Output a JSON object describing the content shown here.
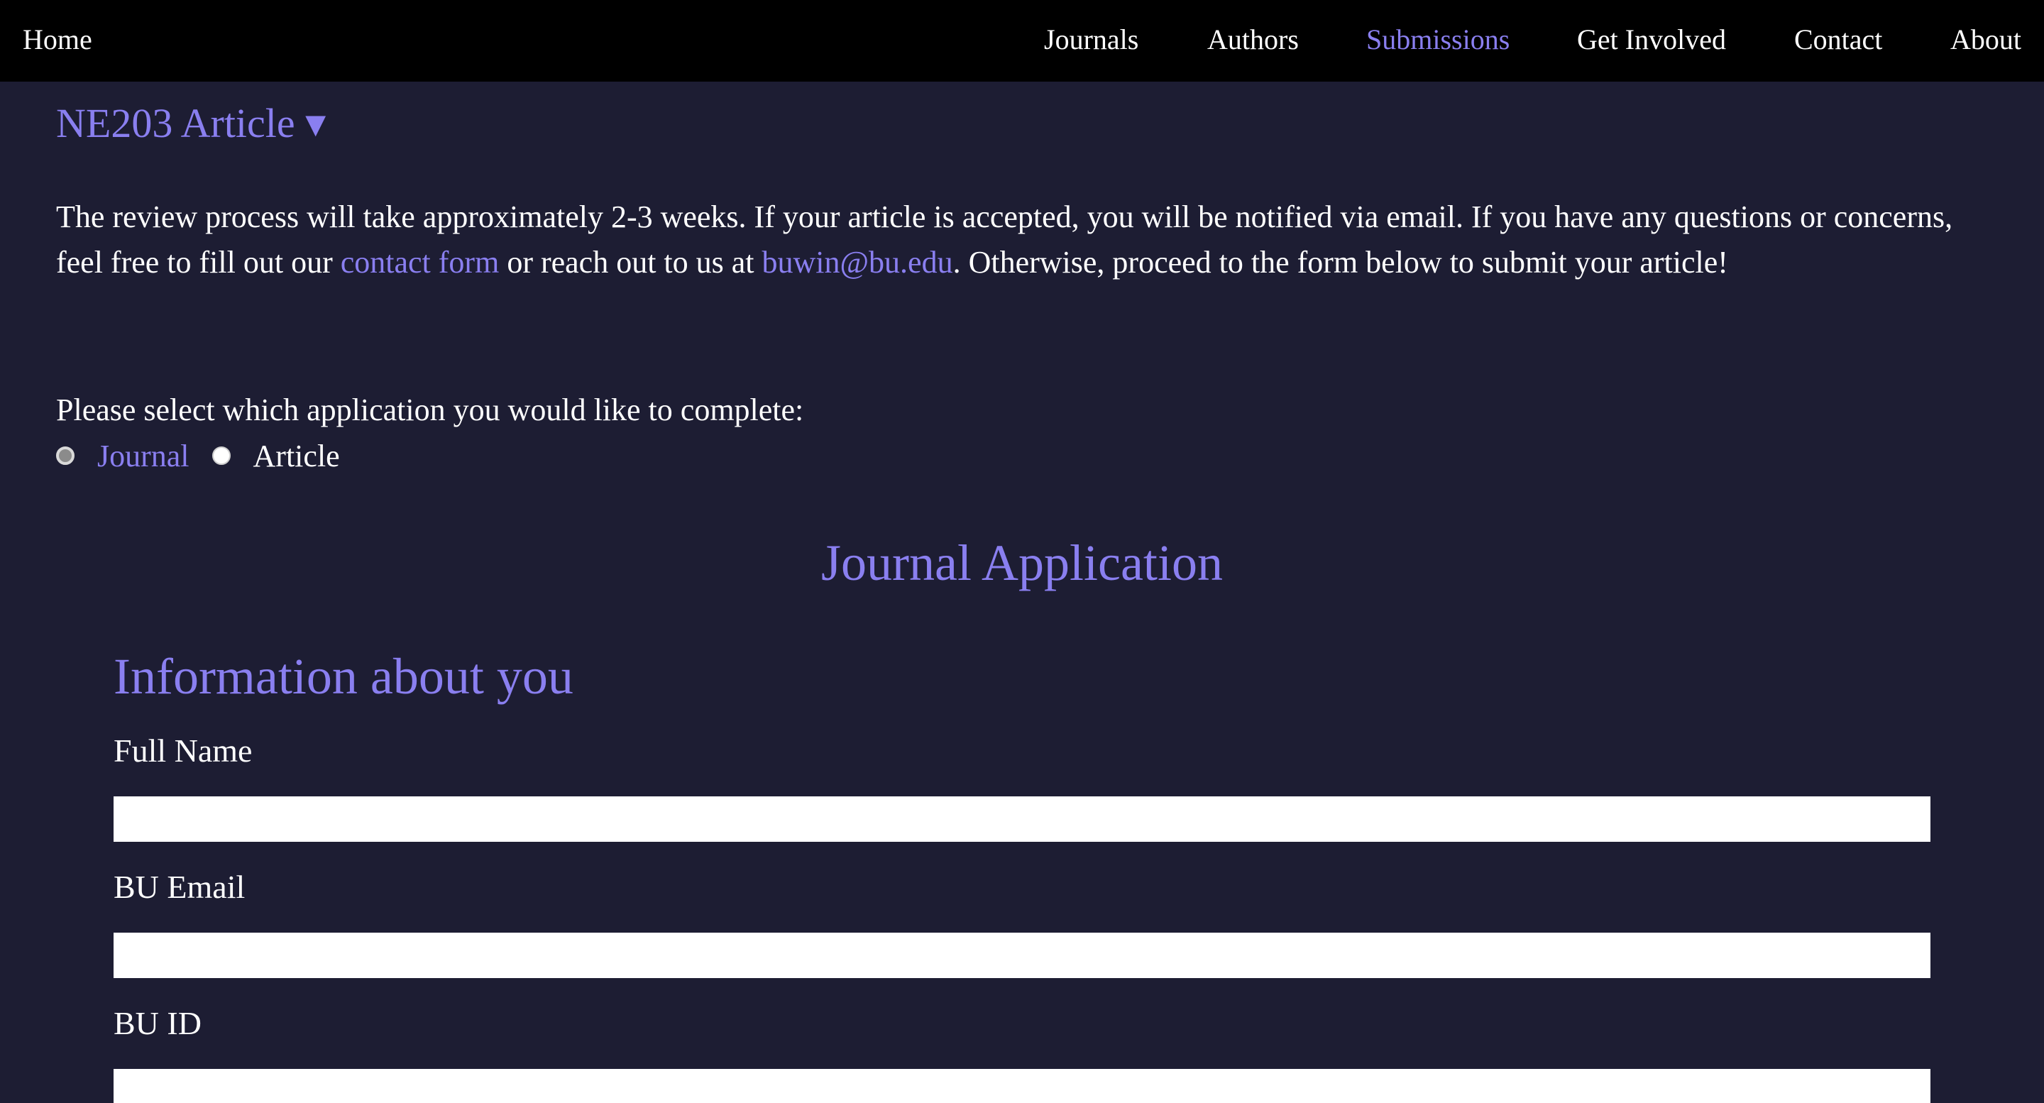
{
  "nav": {
    "home": "Home",
    "items": [
      "Journals",
      "Authors",
      "Submissions",
      "Get Involved",
      "Contact",
      "About"
    ],
    "active": "Submissions"
  },
  "section": {
    "toggle_label": "NE203 Article ▾"
  },
  "intro": {
    "part1": "The review process will take approximately 2-3 weeks. If your article is accepted, you will be notified via email. If you have any questions or concerns, feel free to fill out our ",
    "contact_link": "contact form",
    "part2": " or reach out to us at ",
    "email_link": "buwin@bu.edu",
    "part3": ". Otherwise, proceed to the form below to submit your article!"
  },
  "application_select": {
    "prompt": "Please select which application you would like to complete:",
    "options": [
      "Journal",
      "Article"
    ],
    "selected": "Journal"
  },
  "form": {
    "title": "Journal Application",
    "section_title": "Information about you",
    "fields": [
      {
        "label": "Full Name",
        "value": ""
      },
      {
        "label": "BU Email",
        "value": ""
      },
      {
        "label": "BU ID",
        "value": ""
      }
    ]
  },
  "colors": {
    "accent": "#8a7ff0",
    "background": "#1d1d33",
    "nav_background": "#000000",
    "text": "#ffffff"
  }
}
